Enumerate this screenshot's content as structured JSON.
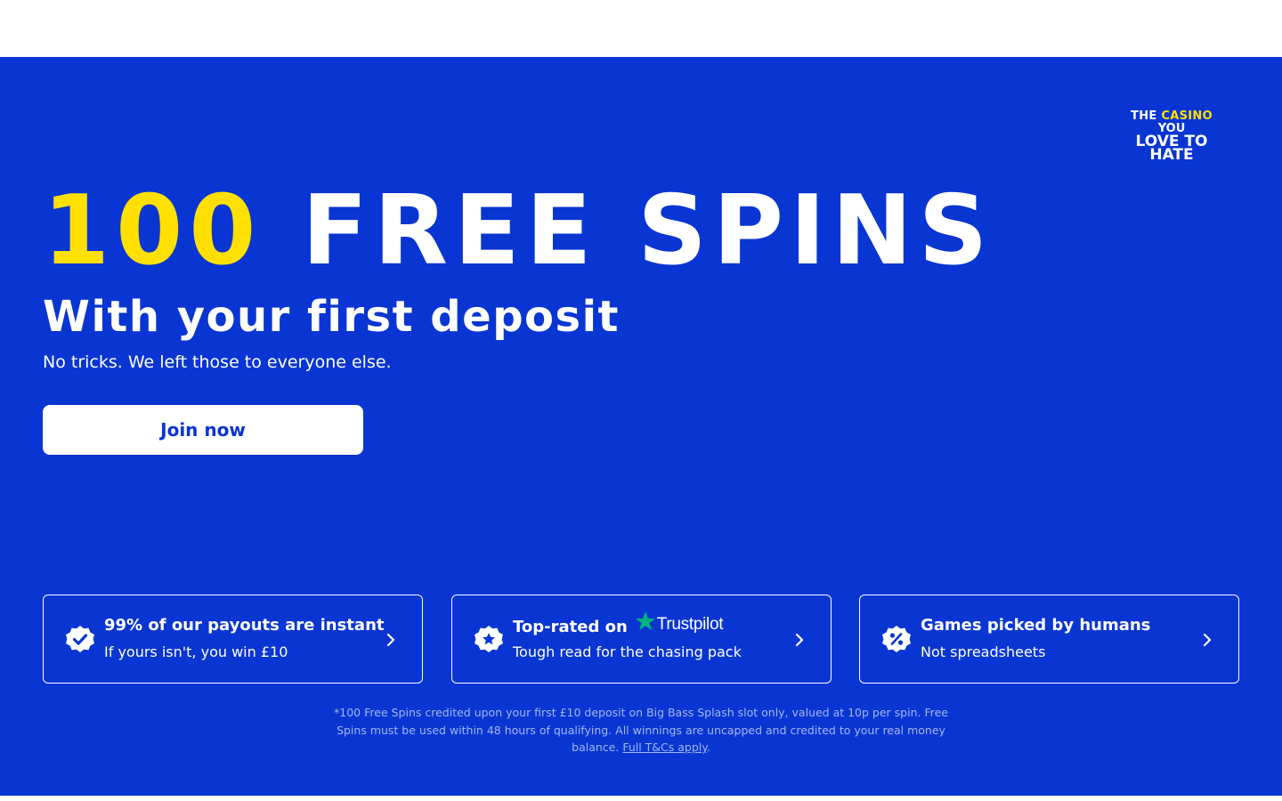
{
  "logo": {
    "line1_a": "THE",
    "line1_b": "CASINO",
    "line2": "YOU",
    "line3": "LOVE TO",
    "line4": "HATE"
  },
  "hero": {
    "headline_number": "100",
    "headline_text": "FREE SPINS",
    "subheadline": "With your first deposit",
    "tagline": "No tricks. We left those to everyone else.",
    "cta_label": "Join now"
  },
  "features": [
    {
      "title": "99% of our payouts are instant",
      "subtitle": "If yours isn't, you win £10",
      "icon": "verified-badge-icon"
    },
    {
      "title": "Top-rated on",
      "brand": "Trustpilot",
      "subtitle": "Tough read for the chasing pack",
      "icon": "star-badge-icon"
    },
    {
      "title": "Games picked by humans",
      "subtitle": "Not spreadsheets",
      "icon": "percent-badge-icon"
    }
  ],
  "disclaimer": {
    "text": "*100 Free Spins credited upon your first £10 deposit on Big Bass Splash slot only, valued at 10p per spin. Free Spins must be used within 48 hours of qualifying. All winnings are uncapped and credited to your real money balance.",
    "link_label": "Full T&Cs apply",
    "trailing": "."
  },
  "colors": {
    "brand_blue": "#0935d2",
    "accent_yellow": "#ffe000",
    "trustpilot_green": "#00b67a"
  }
}
